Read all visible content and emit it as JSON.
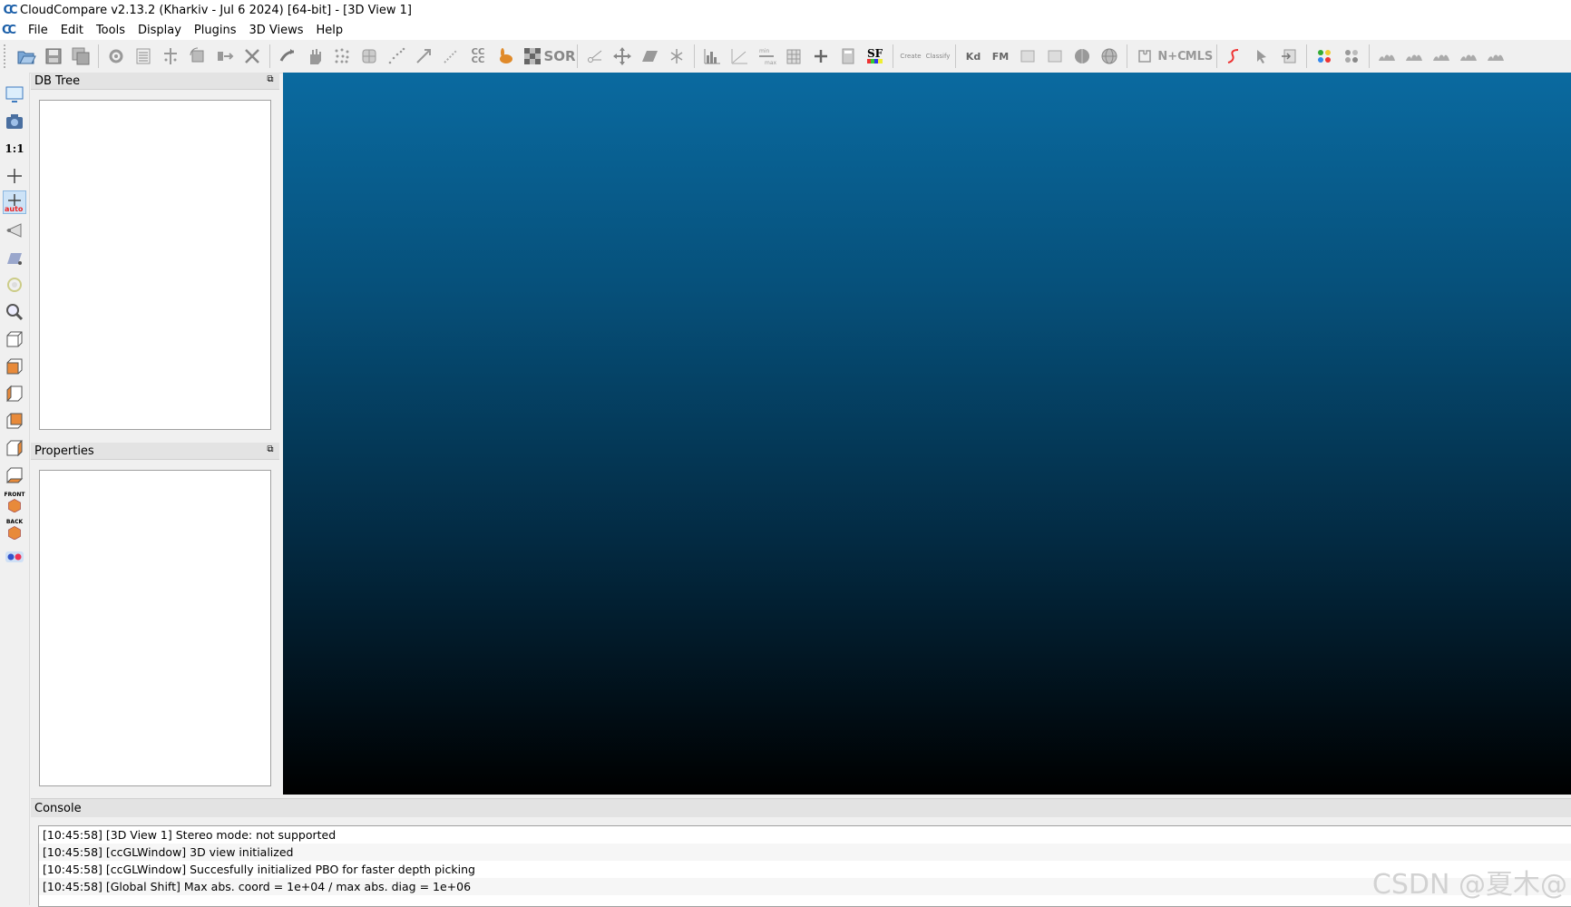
{
  "window": {
    "title": "CloudCompare v2.13.2 (Kharkiv - Jul  6 2024) [64-bit] - [3D View 1]",
    "logo": "CC"
  },
  "menu": {
    "items": [
      "File",
      "Edit",
      "Tools",
      "Display",
      "Plugins",
      "3D Views",
      "Help"
    ]
  },
  "left_toolbar": {
    "ratio_label": "1:1",
    "auto_label": "auto",
    "front_label": "FRONT",
    "back_label": "BACK"
  },
  "toolbar": {
    "cc_label": "CC\nCC",
    "sor_label": "SOR",
    "sf_label": "SF",
    "kd_label": "Kd",
    "fm_label": "FM",
    "nc_label": "N+C",
    "mls_label": "MLS",
    "canupo_create": "Create",
    "canupo_classify": "Classify"
  },
  "panels": {
    "db_tree_title": "DB Tree",
    "properties_title": "Properties",
    "console_title": "Console"
  },
  "console": {
    "lines": [
      "[10:45:58] [3D View 1] Stereo mode: not supported",
      "[10:45:58] [ccGLWindow] 3D view initialized",
      "[10:45:58] [ccGLWindow] Succesfully initialized PBO for faster depth picking",
      "[10:45:58] [Global Shift] Max abs. coord = 1e+04 / max abs. diag = 1e+06"
    ]
  },
  "watermark": "CSDN @夏木@"
}
